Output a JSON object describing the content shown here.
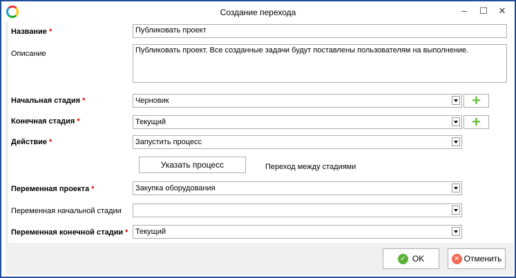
{
  "window": {
    "title": "Создание перехода"
  },
  "fields": {
    "name_label": "Название",
    "name_value": "Публиковать проект",
    "desc_label": "Описание",
    "desc_value": "Публиковать проект. Все созданные задачи будут поставлены пользователям на выполнение.",
    "start_label": "Начальная стадия",
    "start_value": "Черновик",
    "end_label": "Конечная стадия",
    "end_value": "Текущий",
    "action_label": "Действие",
    "action_value": "Запустить процесс",
    "specify_process": "Указать процесс",
    "transition_note": "Переход между стадиями",
    "proj_var_label": "Переменная проекта",
    "proj_var_value": "Закупка оборудования",
    "start_var_label": "Переменная начальной стадии",
    "start_var_value": "",
    "end_var_label": "Переменная конечной стадии",
    "end_var_value": "Текущий"
  },
  "required_mark": "*",
  "footer": {
    "ok": "OK",
    "cancel": "Отменить"
  },
  "colors": {
    "border": "#1f4e9a",
    "plus": "#6cbf3e",
    "ok": "#5ab03a",
    "cancel": "#ee6a55"
  }
}
